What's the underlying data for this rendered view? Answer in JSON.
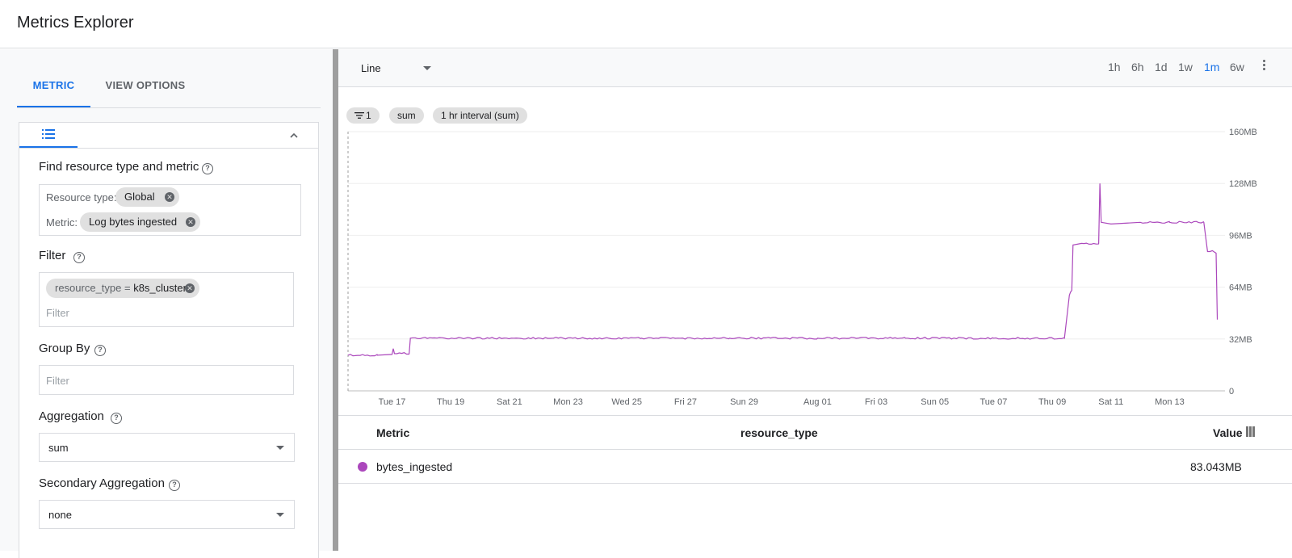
{
  "app": {
    "title": "Metrics Explorer"
  },
  "left": {
    "tabs": [
      {
        "label": "METRIC"
      },
      {
        "label": "VIEW OPTIONS"
      }
    ],
    "find": {
      "label": "Find resource type and metric",
      "resource_type_label": "Resource type:",
      "resource_type_value": "Global",
      "metric_label": "Metric:",
      "metric_value": "Log bytes ingested"
    },
    "filter": {
      "label": "Filter",
      "chip_key": "resource_type = ",
      "chip_value": "k8s_cluster",
      "placeholder": "Filter"
    },
    "group_by": {
      "label": "Group By",
      "placeholder": "Filter"
    },
    "aggregation": {
      "label": "Aggregation",
      "value": "sum"
    },
    "secondary_aggregation": {
      "label": "Secondary Aggregation",
      "value": "none"
    }
  },
  "toolbar": {
    "chart_type": "Line",
    "ranges": [
      "1h",
      "6h",
      "1d",
      "1w",
      "1m",
      "6w"
    ],
    "active_range": "1m"
  },
  "pills": {
    "filter_count": "1",
    "aggregation": "sum",
    "interval": "1 hr interval (sum)"
  },
  "table": {
    "headers": {
      "metric": "Metric",
      "resource_type": "resource_type",
      "value": "Value"
    },
    "rows": [
      {
        "metric": "bytes_ingested",
        "resource_type": "",
        "value": "83.043MB",
        "color": "#ab47bc"
      }
    ]
  },
  "colors": {
    "accent": "#1a73e8",
    "series": "#ab47bc"
  },
  "chart_data": {
    "type": "line",
    "title": "",
    "xlabel": "",
    "ylabel": "",
    "x_ticks": [
      "Tue 17",
      "Thu 19",
      "Sat 21",
      "Mon 23",
      "Wed 25",
      "Fri 27",
      "Sun 29",
      "Aug 01",
      "Fri 03",
      "Sun 05",
      "Tue 07",
      "Thu 09",
      "Sat 11",
      "Mon 13"
    ],
    "y_ticks": [
      "0",
      "32MB",
      "64MB",
      "96MB",
      "128MB",
      "160MB"
    ],
    "ylim": [
      0,
      160
    ],
    "y_unit": "MB",
    "series": [
      {
        "name": "bytes_ingested",
        "points": [
          [
            "Jul 16 00:00",
            22
          ],
          [
            "Jul 17 00:00",
            22
          ],
          [
            "Jul 17 12:00",
            22.5
          ],
          [
            "Jul 17 13:00",
            26
          ],
          [
            "Jul 17 14:00",
            23
          ],
          [
            "Jul 18 02:00",
            23
          ],
          [
            "Jul 18 03:00",
            32.5
          ],
          [
            "Jul 20 00:00",
            32.5
          ],
          [
            "Jul 23 00:00",
            32.5
          ],
          [
            "Jul 26 00:00",
            32.5
          ],
          [
            "Jul 29 00:00",
            32.5
          ],
          [
            "Aug 01 00:00",
            32.5
          ],
          [
            "Aug 04 00:00",
            32.5
          ],
          [
            "Aug 07 00:00",
            32.5
          ],
          [
            "Aug 09 10:00",
            32.5
          ],
          [
            "Aug 09 14:00",
            59
          ],
          [
            "Aug 09 15:00",
            61
          ],
          [
            "Aug 09 16:00",
            62
          ],
          [
            "Aug 09 17:00",
            90
          ],
          [
            "Aug 10 00:00",
            91
          ],
          [
            "Aug 10 14:00",
            91
          ],
          [
            "Aug 10 15:00",
            128
          ],
          [
            "Aug 10 16:00",
            104
          ],
          [
            "Aug 11 00:00",
            103
          ],
          [
            "Aug 12 00:00",
            104
          ],
          [
            "Aug 13 00:00",
            104
          ],
          [
            "Aug 14 04:00",
            104
          ],
          [
            "Aug 14 07:00",
            86
          ],
          [
            "Aug 14 12:00",
            86
          ],
          [
            "Aug 14 14:00",
            85
          ],
          [
            "Aug 14 15:00",
            44
          ]
        ]
      }
    ],
    "grid": true
  }
}
